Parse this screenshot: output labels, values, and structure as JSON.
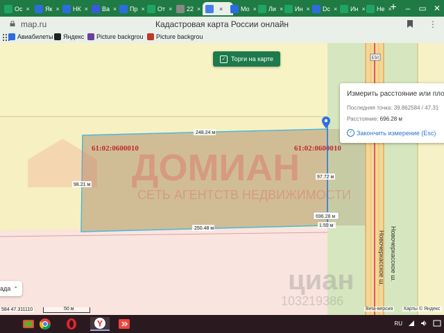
{
  "browser": {
    "tabs": [
      {
        "label": "Ос",
        "color": "#1fa463"
      },
      {
        "label": "Як",
        "color": "#2d6cdf"
      },
      {
        "label": "НК",
        "color": "#2d6cdf"
      },
      {
        "label": "Ва",
        "color": "#3a5bd9"
      },
      {
        "label": "Пр",
        "color": "#2d6cdf"
      },
      {
        "label": "От",
        "color": "#1fa463"
      },
      {
        "label": "22",
        "color": "#888888"
      },
      {
        "label": "",
        "color": "#4a7ee8",
        "active": true
      },
      {
        "label": "Мо",
        "color": "#2d6cdf"
      },
      {
        "label": "Ли",
        "color": "#1fa463"
      },
      {
        "label": "Ин",
        "color": "#1fa463"
      },
      {
        "label": "Dc",
        "color": "#2d6cdf"
      },
      {
        "label": "Ин",
        "color": "#1fa463"
      },
      {
        "label": "Не",
        "color": "#1fa463"
      }
    ],
    "close_glyph": "×",
    "new_tab_glyph": "+",
    "url": "map.ru",
    "page_title": "Кадастровая карта России онлайн",
    "bookmarks": [
      {
        "label": "Авиабилеты",
        "color": "#2d6cdf"
      },
      {
        "label": "Яндекс",
        "color": "#222222"
      },
      {
        "label": "Picture backgrou",
        "color": "#6b3fa0"
      },
      {
        "label": "Picture backgrou",
        "color": "#c0392b"
      }
    ]
  },
  "map": {
    "torgi_label": "Торги на карте",
    "road_label_top": "Е50",
    "street_label": "Новочеркасское ш.",
    "street_label_2": "Новочеркасское ш.",
    "parcel_ids": [
      "61:02:0600010",
      "61:02:0600010"
    ],
    "dim_labels": [
      "248.24 м",
      "98.21 м",
      "97.72 м",
      "250.48 м",
      "1.59 м",
      "696.28 м"
    ],
    "watermark_main": "ДОМИАН",
    "watermark_sub": "СЕТЬ АГЕНТСТВ НЕДВИЖИМОСТИ",
    "watermark_cian": "циан",
    "watermark_cian_id": "103219386",
    "measure": {
      "title": "Измерить расстояние или площ",
      "last_point_label": "Последняя точка:",
      "last_point_value": "39.862584 / 47.31",
      "distance_label": "Расстояние:",
      "distance_value": "696.28 м",
      "finish_label": "Закончить измерение (Esc)"
    },
    "layers_label": "ада",
    "coords": "584  47.311110",
    "scale_label": "50 м",
    "beta_label": "Beta-версия",
    "attribution": "Карты © Яндекс"
  },
  "taskbar": {
    "apps": [
      "windows-media",
      "chrome",
      "opera",
      "yandex-browser",
      "anydesk"
    ],
    "lang": "RU"
  }
}
